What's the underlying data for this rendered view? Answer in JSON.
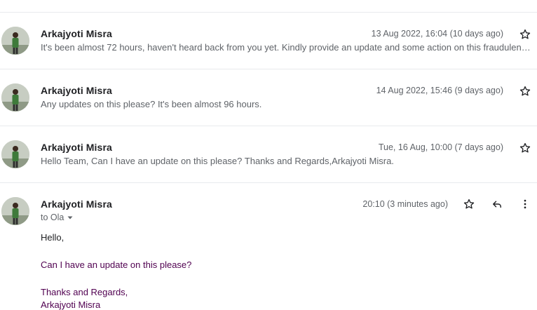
{
  "messages": [
    {
      "sender": "Arkajyoti Misra",
      "date": "13 Aug 2022, 16:04 (10 days ago)",
      "snippet": "It's been almost 72 hours, haven't heard back from you yet. Kindly provide an update and some action on this fraudulent transaction."
    },
    {
      "sender": "Arkajyoti Misra",
      "date": "14 Aug 2022, 15:46 (9 days ago)",
      "snippet": "Any updates on this please? It's been almost 96 hours."
    },
    {
      "sender": "Arkajyoti Misra",
      "date": "Tue, 16 Aug, 10:00 (7 days ago)",
      "snippet": "Hello Team, Can I have an update on this please? Thanks and Regards,Arkajyoti Misra."
    }
  ],
  "open_message": {
    "sender": "Arkajyoti Misra",
    "date": "20:10 (3 minutes ago)",
    "to_label": "to Ola",
    "greeting": "Hello,",
    "body_line": "Can I have an update on this please?",
    "closing": "Thanks and Regards,",
    "signature": "Arkajyoti Misra"
  },
  "icons": {
    "star": "star-outline-icon",
    "reply": "reply-icon",
    "more": "more-vertical-icon",
    "dropdown": "caret-down-icon"
  },
  "colors": {
    "quoted_text": "#500050",
    "secondary_text": "#5f6368",
    "divider": "#e8eaed"
  }
}
